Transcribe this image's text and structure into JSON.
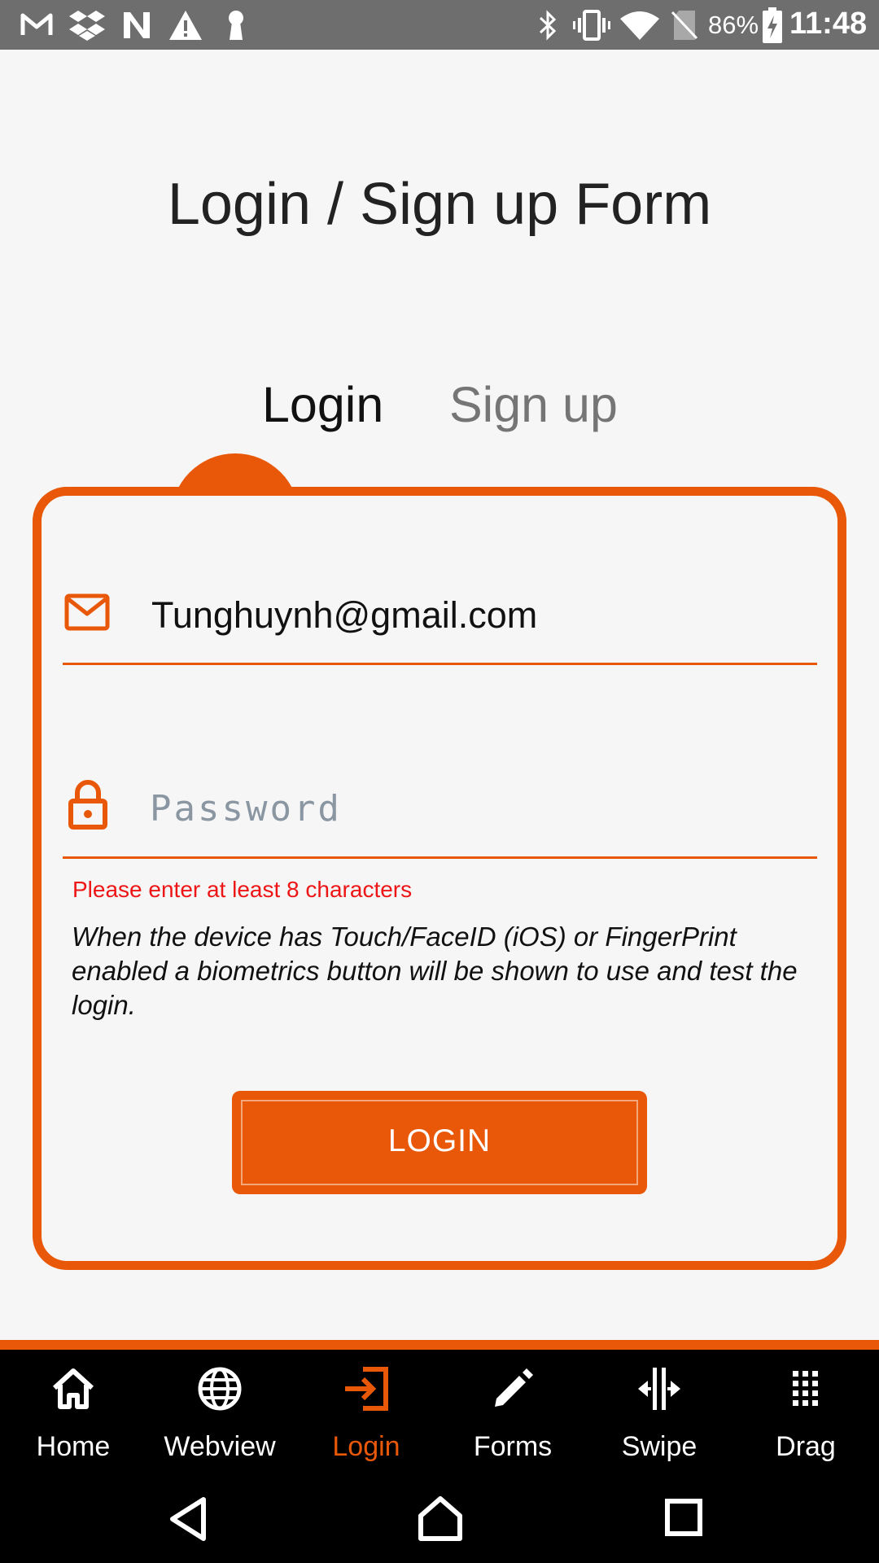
{
  "status_bar": {
    "battery_percent": "86%",
    "time": "11:48",
    "left_icons": [
      "gmail-icon",
      "dropbox-icon",
      "n-icon",
      "warning-icon",
      "keyhole-icon"
    ],
    "right_icons": [
      "bluetooth-icon",
      "vibrate-icon",
      "wifi-icon",
      "no-sim-icon",
      "battery-charging-icon"
    ]
  },
  "page": {
    "title": "Login / Sign up Form"
  },
  "tabs": [
    {
      "label": "Login",
      "active": true
    },
    {
      "label": "Sign up",
      "active": false
    }
  ],
  "form": {
    "email_value": "Tunghuynh@gmail.com",
    "password_value": "",
    "password_placeholder": "Password",
    "error_message": "Please enter at least 8 characters",
    "hint": "When the device has Touch/FaceID (iOS) or FingerPrint enabled a biometrics button will be shown to use and test the login.",
    "submit_label": "LOGIN"
  },
  "bottom_nav": [
    {
      "label": "Home",
      "icon": "home-icon",
      "active": false
    },
    {
      "label": "Webview",
      "icon": "globe-icon",
      "active": false
    },
    {
      "label": "Login",
      "icon": "login-icon",
      "active": true
    },
    {
      "label": "Forms",
      "icon": "pencil-icon",
      "active": false
    },
    {
      "label": "Swipe",
      "icon": "swipe-icon",
      "active": false
    },
    {
      "label": "Drag",
      "icon": "grid-dots-icon",
      "active": false
    }
  ],
  "colors": {
    "accent": "#e95808",
    "error": "#ed1515",
    "status_bar": "#6e6e6e",
    "background": "#f6f6f6"
  }
}
